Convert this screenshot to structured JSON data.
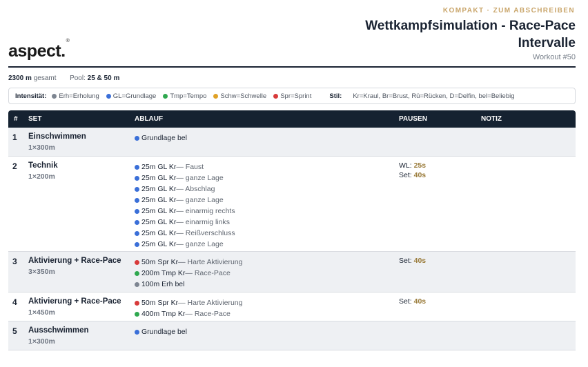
{
  "header": {
    "kicker": "KOMPAKT · ZUM ABSCHREIBEN",
    "title_line1": "Wettkampfsimulation - Race-Pace",
    "title_line2": "Intervalle",
    "workout_number": "Workout #50",
    "logo": "aspect.",
    "logo_mark": "®"
  },
  "meta": {
    "total_value": "2300 m",
    "total_label": "gesamt",
    "pool_label": "Pool:",
    "pool_value": "25 & 50 m"
  },
  "legend": {
    "intensity_label": "Intensität:",
    "items": [
      {
        "text": "Erh=Erholung",
        "color": "#7d8591"
      },
      {
        "text": "GL=Grundlage",
        "color": "#3a6fd8"
      },
      {
        "text": "Tmp=Tempo",
        "color": "#2fa84f"
      },
      {
        "text": "Schw=Schwelle",
        "color": "#e0a126"
      },
      {
        "text": "Spr=Sprint",
        "color": "#d83a3a"
      }
    ],
    "style_label": "Stil:",
    "style_text": "Kr=Kraul, Br=Brust, Rü=Rücken, D=Delfin, bel=Beliebig"
  },
  "table": {
    "headers": {
      "num": "#",
      "set": "SET",
      "steps": "ABLAUF",
      "pauses": "PAUSEN",
      "note": "NOTIZ"
    },
    "rows": [
      {
        "num": "1",
        "name": "Einschwimmen",
        "count": "1×300m",
        "steps": [
          {
            "main": "Grundlage bel",
            "detail": "",
            "color": "#3a6fd8"
          }
        ],
        "pauses": []
      },
      {
        "num": "2",
        "name": "Technik",
        "count": "1×200m",
        "steps": [
          {
            "main": "25m GL Kr",
            "detail": " — Faust",
            "color": "#3a6fd8"
          },
          {
            "main": "25m GL Kr",
            "detail": " — ganze Lage",
            "color": "#3a6fd8"
          },
          {
            "main": "25m GL Kr",
            "detail": " — Abschlag",
            "color": "#3a6fd8"
          },
          {
            "main": "25m GL Kr",
            "detail": " — ganze Lage",
            "color": "#3a6fd8"
          },
          {
            "main": "25m GL Kr",
            "detail": " — einarmig rechts",
            "color": "#3a6fd8"
          },
          {
            "main": "25m GL Kr",
            "detail": " — einarmig links",
            "color": "#3a6fd8"
          },
          {
            "main": "25m GL Kr",
            "detail": " — Reißverschluss",
            "color": "#3a6fd8"
          },
          {
            "main": "25m GL Kr",
            "detail": " — ganze Lage",
            "color": "#3a6fd8"
          }
        ],
        "pauses": [
          {
            "label": "WL: ",
            "value": "25s"
          },
          {
            "label": "Set: ",
            "value": "40s"
          }
        ]
      },
      {
        "num": "3",
        "name": "Aktivierung + Race-Pace",
        "count": "3×350m",
        "steps": [
          {
            "main": "50m Spr Kr",
            "detail": " — Harte Aktivierung",
            "color": "#d83a3a"
          },
          {
            "main": "200m Tmp Kr",
            "detail": " — Race-Pace",
            "color": "#2fa84f"
          },
          {
            "main": "100m Erh bel",
            "detail": "",
            "color": "#7d8591"
          }
        ],
        "pauses": [
          {
            "label": "Set: ",
            "value": "40s"
          }
        ]
      },
      {
        "num": "4",
        "name": "Aktivierung + Race-Pace",
        "count": "1×450m",
        "steps": [
          {
            "main": "50m Spr Kr",
            "detail": " — Harte Aktivierung",
            "color": "#d83a3a"
          },
          {
            "main": "400m Tmp Kr",
            "detail": " — Race-Pace",
            "color": "#2fa84f"
          }
        ],
        "pauses": [
          {
            "label": "Set: ",
            "value": "40s"
          }
        ]
      },
      {
        "num": "5",
        "name": "Ausschwimmen",
        "count": "1×300m",
        "steps": [
          {
            "main": "Grundlage bel",
            "detail": "",
            "color": "#3a6fd8"
          }
        ],
        "pauses": []
      }
    ]
  }
}
